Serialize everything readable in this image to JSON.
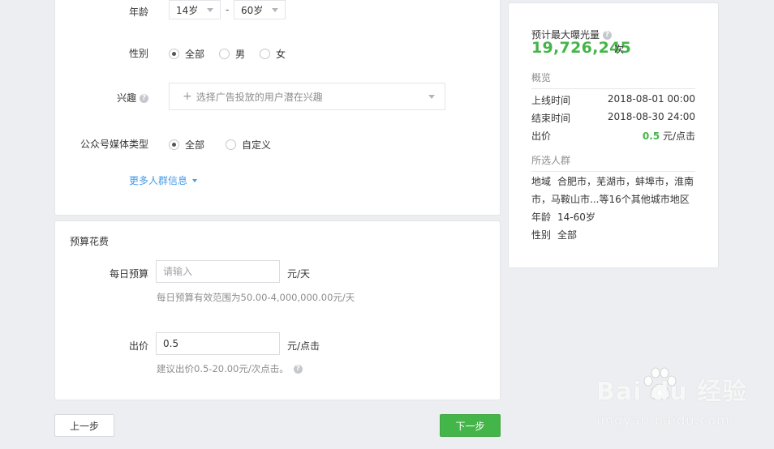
{
  "targeting": {
    "age": {
      "label": "年龄",
      "from": "14岁",
      "separator": "-",
      "to": "60岁"
    },
    "gender": {
      "label": "性别",
      "options": [
        "全部",
        "男",
        "女"
      ],
      "selected": "全部"
    },
    "interest": {
      "label": "兴趣",
      "placeholder": "选择广告投放的用户潜在兴趣"
    },
    "media_type": {
      "label": "公众号媒体类型",
      "options": [
        "全部",
        "自定义"
      ],
      "selected": "全部"
    },
    "more_link": "更多人群信息"
  },
  "budget": {
    "title": "预算花费",
    "daily": {
      "label": "每日预算",
      "placeholder": "请输入",
      "value": "",
      "unit": "元/天",
      "hint": "每日预算有效范围为50.00-4,000,000.00元/天"
    },
    "bid": {
      "label": "出价",
      "value": "0.5",
      "unit": "元/点击",
      "hint": "建议出价0.5-20.00元/次点击。"
    }
  },
  "buttons": {
    "prev": "上一步",
    "next": "下一步"
  },
  "summary": {
    "exposure_label": "预计最大曝光量",
    "exposure_value": "19,726,245",
    "exposure_unit": "次",
    "overview_title": "概览",
    "online_label": "上线时间",
    "online_value": "2018-08-01 00:00",
    "end_label": "结束时间",
    "end_value": "2018-08-30 24:00",
    "bid_label": "出价",
    "bid_value": "0.5",
    "bid_unit": "元/点击",
    "audience_title": "所选人群",
    "region_label": "地域",
    "region_value": "合肥市，芜湖市，蚌埠市，淮南市，马鞍山市...等16个其他城市地区",
    "age_label": "年龄",
    "age_value": "14-60岁",
    "gender_label": "性别",
    "gender_value": "全部"
  },
  "watermark": {
    "brand": "Bai du 经验",
    "url": "jingyan.baidu.com"
  },
  "colors": {
    "accent_green": "#44b549",
    "link_blue": "#459ae9",
    "background": "#eceef1"
  }
}
